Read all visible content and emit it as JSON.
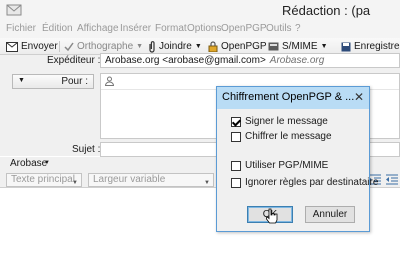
{
  "window": {
    "title": "Rédaction : (pa"
  },
  "menubar": {
    "items": [
      "Fichier",
      "Édition",
      "Affichage",
      "Insérer",
      "Format",
      "Options",
      "OpenPGP",
      "Outils",
      "?"
    ]
  },
  "toolbar": {
    "send_label": "Envoyer",
    "spelling_label": "Orthographe",
    "attach_label": "Joindre",
    "openpgp_label": "OpenPGP",
    "smime_label": "S/MIME",
    "save_label": "Enregistrer"
  },
  "headers": {
    "from_label": "Expéditeur :",
    "from_value": "Arobase.org <arobase@gmail.com>",
    "from_alias": "Arobase.org",
    "to_type": "Pour :",
    "subject_label": "Sujet :"
  },
  "format_bar": {
    "label": "Arobase"
  },
  "format_toolbar": {
    "paragraph_style": "Texte principal",
    "font": "Largeur variable"
  },
  "dialog": {
    "title": "Chiffrement OpenPGP & ...",
    "options": [
      {
        "label": "Signer le message",
        "checked": true
      },
      {
        "label": "Chiffrer le message",
        "checked": false
      },
      {
        "label": "Utiliser PGP/MIME",
        "checked": false
      },
      {
        "label": "Ignorer règles par destinataire",
        "checked": false
      }
    ],
    "ok_label": "OK",
    "cancel_label": "Annuler"
  }
}
